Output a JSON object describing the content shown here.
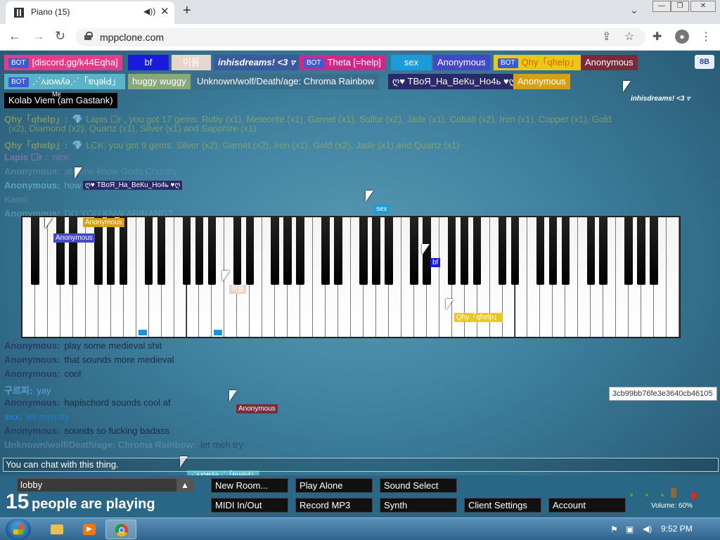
{
  "browser": {
    "tab_title": "Piano (15)",
    "tab_audio_icon": "speaker-icon",
    "close_glyph": "✕",
    "new_tab_glyph": "+",
    "url": "mppclone.com"
  },
  "users": {
    "row1": [
      {
        "bot": true,
        "name": "[discord.gg/k44Eqha]",
        "bg": "#e83a8a",
        "fg": "#ffffff"
      },
      {
        "bot": false,
        "name": "bf",
        "bg": "#1a1adb",
        "fg": "#ffffff"
      },
      {
        "bot": false,
        "name": "이름",
        "bg": "#e8d6cc",
        "fg": "#ffffff"
      },
      {
        "bot": false,
        "name": "inhisdreams! <3 ▿",
        "bg": "#3a5aa0",
        "fg": "#ffffff"
      },
      {
        "bot": true,
        "name": "Theta [=help]",
        "bg": "#d2278a",
        "fg": "#ffffff"
      },
      {
        "bot": false,
        "name": "sex",
        "bg": "#1c9bdb",
        "fg": "#ffffff"
      },
      {
        "bot": false,
        "name": "Anonymous",
        "bg": "#4448c8",
        "fg": "#ffffff"
      },
      {
        "bot": true,
        "name": "Qhy「qhelp」",
        "bg": "#e8c91a",
        "fg": "#e85a00"
      },
      {
        "bot": false,
        "name": "Anonymous",
        "bg": "#7a2a3a",
        "fg": "#ffffff"
      }
    ],
    "row2": [
      {
        "bot": true,
        "name": "⋰ʌɹoʍʎǝ⋰「ɐɥǝlԀ」",
        "bg": "#5ab4c8",
        "fg": "#ffffff"
      },
      {
        "bot": false,
        "name": "huggy wuggy",
        "bg": "#8aa87c",
        "fg": "#ffffff"
      },
      {
        "bot": false,
        "name": "Unknown/wolf/Death/age: Chroma Rainbow",
        "bg": "#3a6e8a",
        "fg": "#ffffff"
      },
      {
        "bot": false,
        "name": "ღ♥ ТВоЯ_На_ВеКu_Но4ь ♥ღ",
        "bg": "#2a2a6a",
        "fg": "#ffffff"
      },
      {
        "bot": false,
        "name": "Anonymous",
        "bg": "#d4a017",
        "fg": "#ffffff"
      }
    ],
    "row3": {
      "name": "Kolab Viem (am Gastank)",
      "me_label": "Me",
      "bg": "#000000"
    },
    "corner_btn": "8B",
    "corner_tag": "inhisdreams! <3 ▿"
  },
  "chat": [
    {
      "name": "Qhy「qhelp」:",
      "msg": "💎 Lapis ☐r , you got 17 gems: Ruby (x1), Meteorite (x1), Garnet (x1), Sulfur (x2), Jade (x1), Cobalt (x2), Iron (x1), Copper (x1), Gold",
      "color": "#b8b84a"
    },
    {
      "name": "",
      "msg": "(x2), Diamond (x2), Quartz (x1), Silver (x1) and Sapphire (x1)",
      "color": "#b8b84a"
    },
    {
      "name": "Qhy「qhelp」:",
      "msg": "💎 LCK, you got 9 gems: Silver (x2), Garnet (x2), Iron (x1), Gold (x2), Jade (x1) and Quartz (x1)",
      "color": "#b8b84a"
    },
    {
      "name": "Lapis ☐r :",
      "msg": "nice",
      "color": "#c27ab8"
    },
    {
      "name": "Anonymous:",
      "msg": "anyone know Gods Country",
      "color": "#6a9aa8"
    },
    {
      "name": "Anonymous:",
      "msg": "how to play with a keybotd",
      "color": "#7ad0e0"
    },
    {
      "name": "Kami:",
      "msg": "",
      "color": "#6a8fa0"
    },
    {
      "name": "Anonymous:",
      "msg": "DO YOU KNW ARIRANG?",
      "color": "#6ab0b8"
    },
    {
      "name": "Anonymous:",
      "msg": "play some medieval shit",
      "color": "#2a3a6a"
    },
    {
      "name": "Anonymous:",
      "msg": "that sounds more medieval",
      "color": "#2a3a6a"
    },
    {
      "name": "Anonymous:",
      "msg": "cool",
      "color": "#2a3a6a"
    },
    {
      "name": "구르피:",
      "msg": "yay",
      "color": "#5aa0d8"
    },
    {
      "name": "Anonymous:",
      "msg": "hapischord sounds cool af",
      "color": "#2a3a6a"
    },
    {
      "name": "sex:",
      "msg": "let meh try",
      "color": "#1c7fd8"
    },
    {
      "name": "Anonymous:",
      "msg": "sounds so fucking badass",
      "color": "#2a3a6a"
    },
    {
      "name": "Unknown/wolf/Death/age: Chroma Rainbow:",
      "msg": "let meh try",
      "color": "#6a9ab0"
    }
  ],
  "cursor_tags": [
    {
      "label": "ღ♥ ТВоЯ_На_ВеКu_Но4ь ♥ღ",
      "bg": "#2a2a6a"
    },
    {
      "label": "sex",
      "bg": "#1c9bdb"
    },
    {
      "label": "Anonymous",
      "bg": "#d4a017"
    },
    {
      "label": "Anonymous",
      "bg": "#4448c8"
    },
    {
      "label": "bf",
      "bg": "#1a1adb"
    },
    {
      "label": "이름",
      "bg": "#e8d6cc"
    },
    {
      "label": "Qhy「qhelp」",
      "bg": "#e8c91a"
    },
    {
      "label": "Anonymous",
      "bg": "#7a2a3a"
    },
    {
      "label": "⋰ʌɹoʍʎǝ⋰「ɐɥǝlԀ」",
      "bg": "#5ab4c8"
    },
    {
      "label": "[discord.gg/k44Eqha]",
      "bg": "#e83a8a"
    }
  ],
  "user_id": "3cb99bb76fe3e3640cb46105",
  "chat_input_placeholder": "You can chat with this thing.",
  "room": {
    "name": "lobby",
    "arrow": "▲"
  },
  "player_count": {
    "number": "15",
    "text": "people are playing"
  },
  "buttons": {
    "new_room": "New Room...",
    "play_alone": "Play Alone",
    "sound_select": "Sound Select",
    "midi": "MIDI In/Out",
    "record_mp3": "Record MP3",
    "synth": "Synth",
    "client_settings": "Client Settings",
    "account": "Account"
  },
  "volume_label": "Volume: 60%",
  "taskbar": {
    "time": "9:52 PM"
  }
}
